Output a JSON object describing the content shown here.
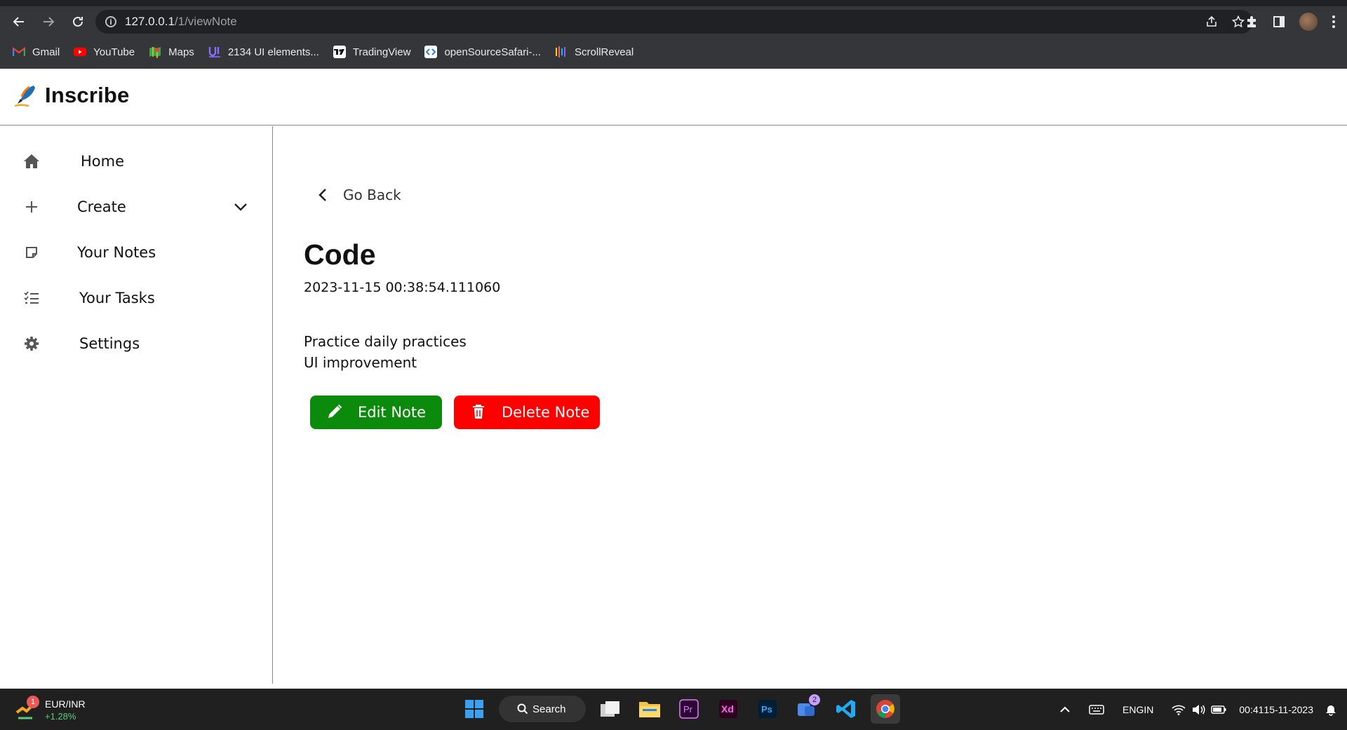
{
  "browser": {
    "url_host": "127.0.0.1",
    "url_path": "/1/viewNote",
    "bookmarks": [
      {
        "label": "Gmail",
        "icon": "gmail-icon"
      },
      {
        "label": "YouTube",
        "icon": "youtube-icon"
      },
      {
        "label": "Maps",
        "icon": "maps-icon"
      },
      {
        "label": "2134 UI elements...",
        "icon": "uiverse-icon"
      },
      {
        "label": "TradingView",
        "icon": "tradingview-icon"
      },
      {
        "label": "openSourceSafari-...",
        "icon": "code-icon"
      },
      {
        "label": "ScrollReveal",
        "icon": "scrollreveal-icon"
      }
    ]
  },
  "app": {
    "brand": "Inscribe"
  },
  "sidebar": {
    "items": [
      {
        "label": "Home",
        "icon": "home-icon"
      },
      {
        "label": "Create",
        "icon": "plus-icon"
      },
      {
        "label": "Your Notes",
        "icon": "note-icon"
      },
      {
        "label": "Your Tasks",
        "icon": "checklist-icon"
      },
      {
        "label": "Settings",
        "icon": "gear-icon"
      }
    ]
  },
  "note": {
    "go_back": "Go Back",
    "title": "Code",
    "timestamp": "2023-11-15 00:38:54.111060",
    "body_lines": [
      "Practice daily practices",
      "UI improvement"
    ],
    "edit_label": "Edit Note",
    "delete_label": "Delete Note"
  },
  "colors": {
    "edit": "#0b8a0b",
    "delete": "#ff0000"
  },
  "taskbar": {
    "widget_title": "EUR/INR",
    "widget_change": "+1.28%",
    "widget_badge": "1",
    "search_label": "Search",
    "teams_badge": "2",
    "lang_top": "ENG",
    "lang_bottom": "IN",
    "time": "00:41",
    "date": "15-11-2023"
  }
}
